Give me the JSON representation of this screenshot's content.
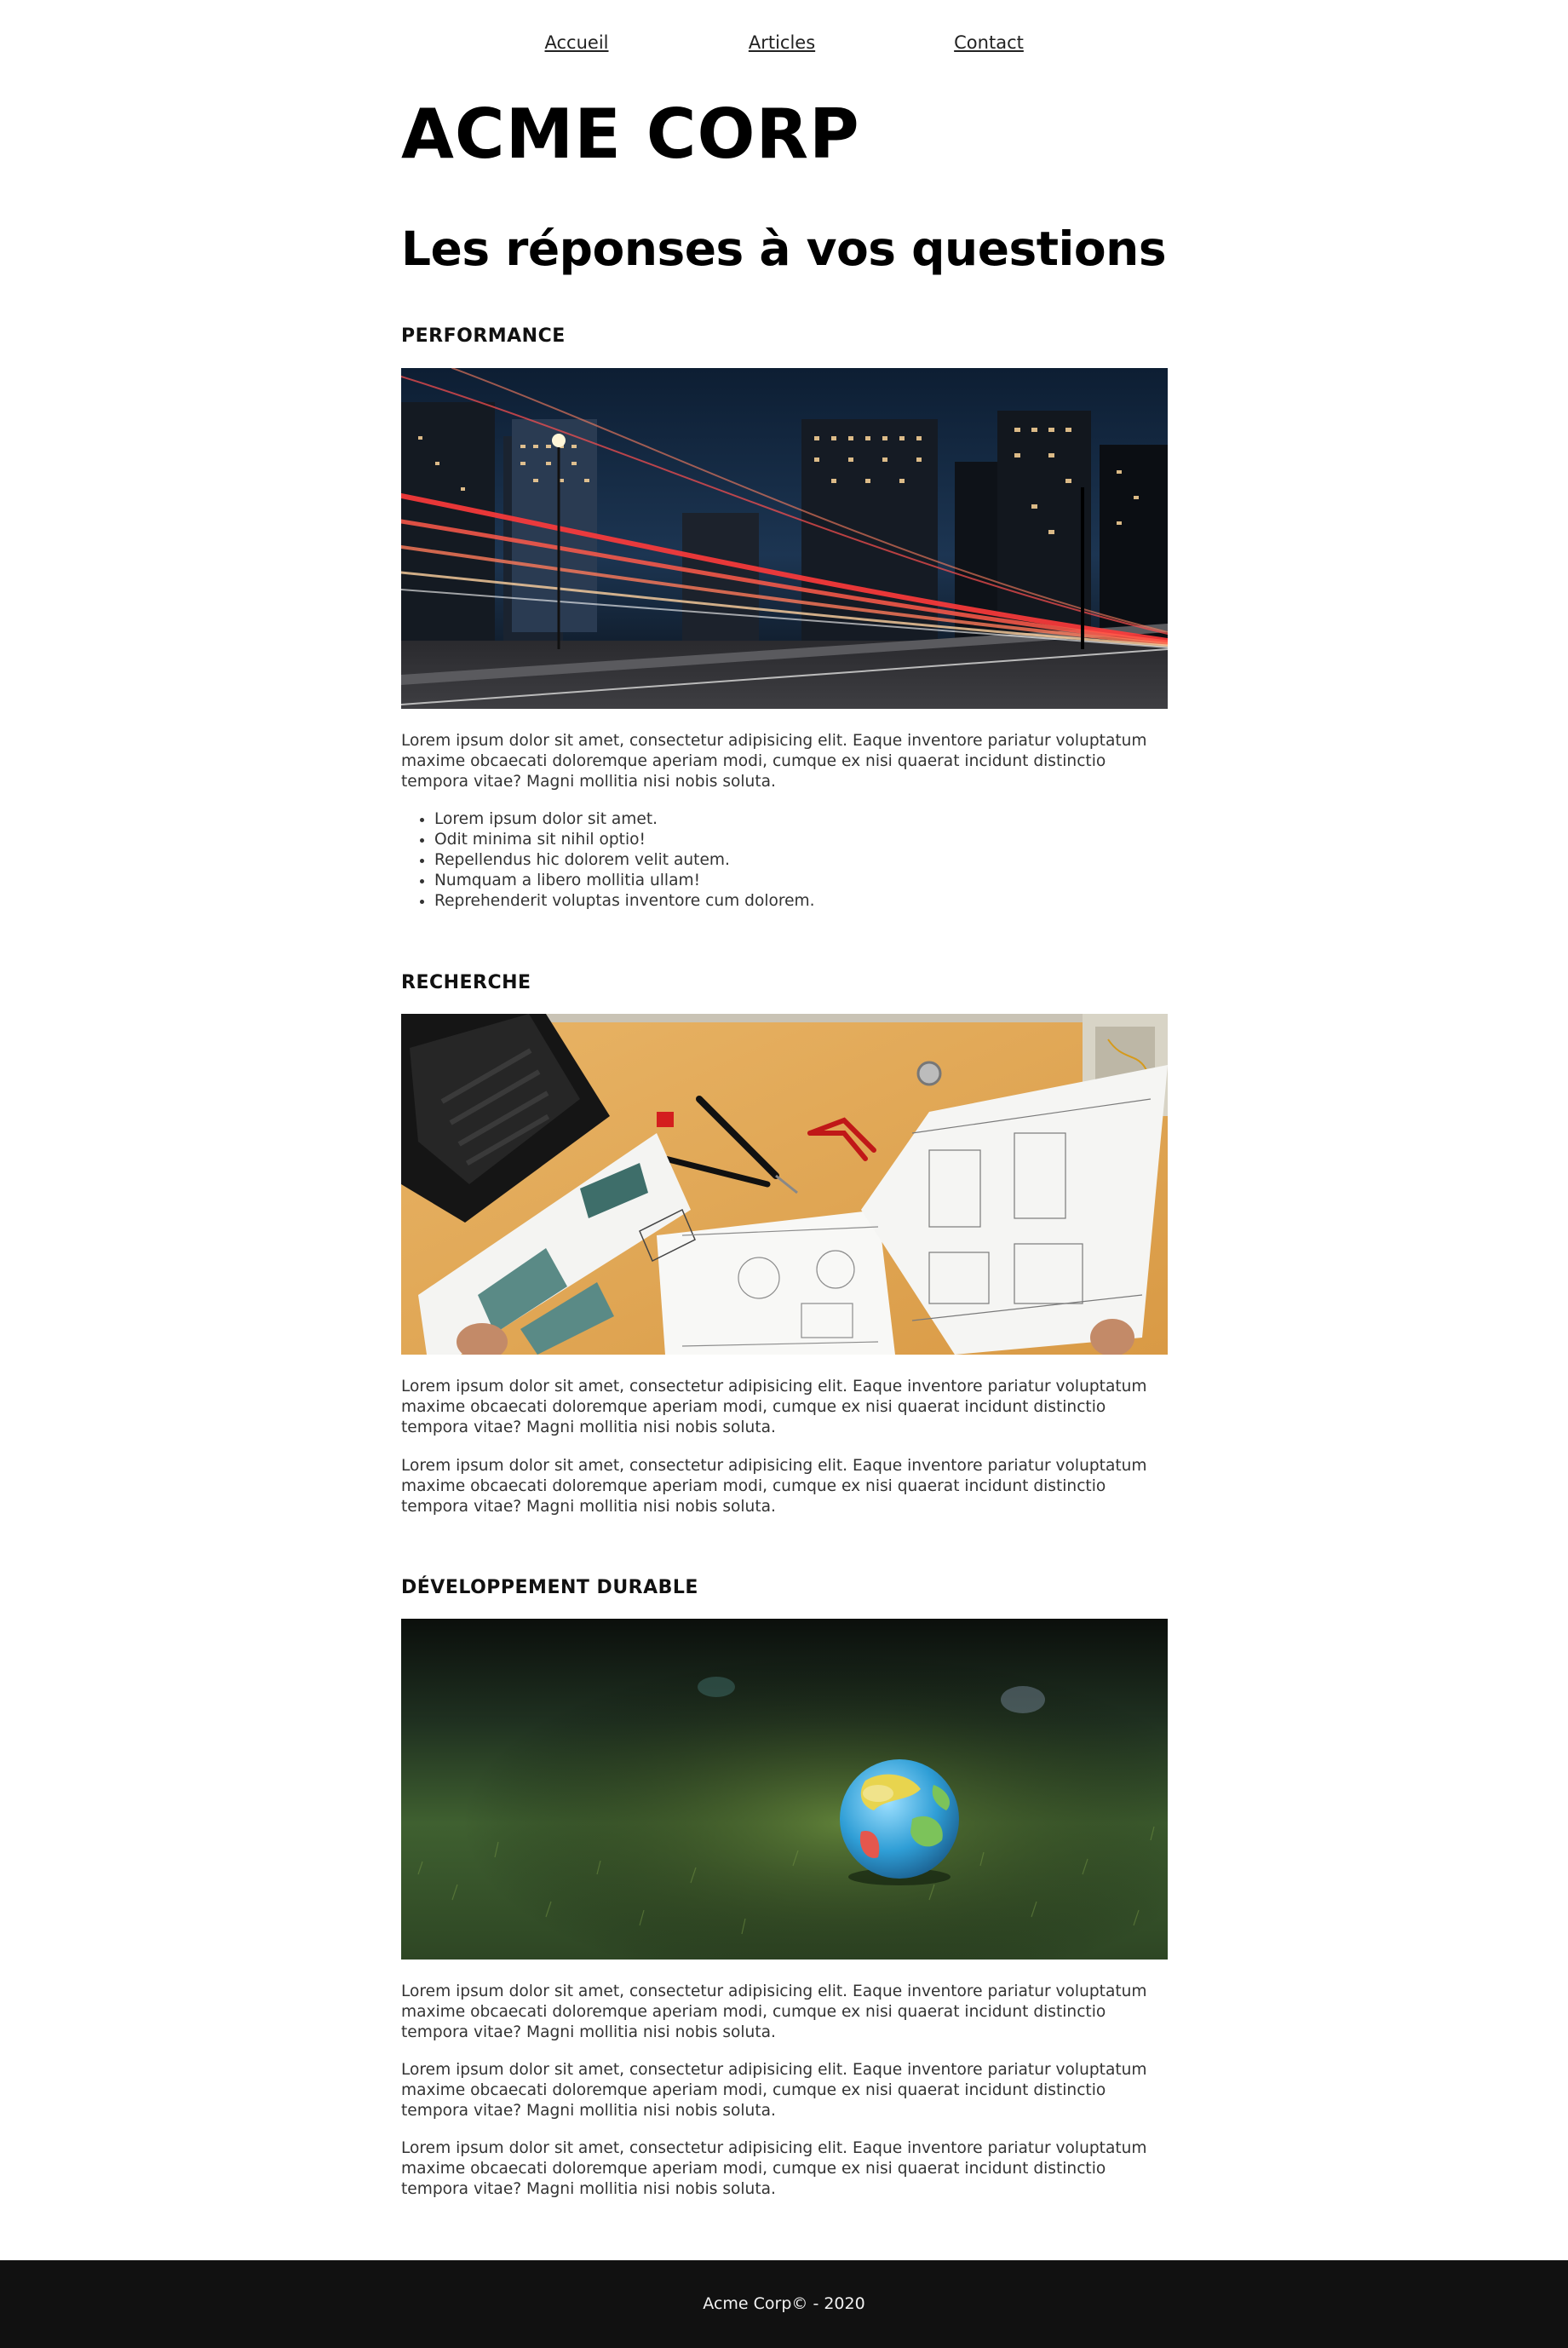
{
  "nav": {
    "items": [
      {
        "label": "Accueil"
      },
      {
        "label": "Articles"
      },
      {
        "label": "Contact"
      }
    ]
  },
  "brand": "ACME CORP",
  "page_title": "Les réponses à vos questions",
  "sections": [
    {
      "title": "PERFORMANCE",
      "image_subject": "city-night-light-trails",
      "paragraphs": [
        "Lorem ipsum dolor sit amet, consectetur adipisicing elit. Eaque inventore pariatur voluptatum maxime obcaecati doloremque aperiam modi, cumque ex nisi quaerat incidunt distinctio tempora vitae? Magni mollitia nisi nobis soluta."
      ],
      "bullets": [
        "Lorem ipsum dolor sit amet.",
        "Odit minima sit nihil optio!",
        "Repellendus hic dolorem velit autem.",
        "Numquam a libero mollitia ullam!",
        "Reprehenderit voluptas inventore cum dolorem."
      ]
    },
    {
      "title": "RECHERCHE",
      "image_subject": "blueprints-on-desk",
      "paragraphs": [
        "Lorem ipsum dolor sit amet, consectetur adipisicing elit. Eaque inventore pariatur voluptatum maxime obcaecati doloremque aperiam modi, cumque ex nisi quaerat incidunt distinctio tempora vitae? Magni mollitia nisi nobis soluta.",
        "Lorem ipsum dolor sit amet, consectetur adipisicing elit. Eaque inventore pariatur voluptatum maxime obcaecati doloremque aperiam modi, cumque ex nisi quaerat incidunt distinctio tempora vitae? Magni mollitia nisi nobis soluta."
      ]
    },
    {
      "title": "DÉVELOPPEMENT DURABLE",
      "image_subject": "globe-on-grass",
      "paragraphs": [
        "Lorem ipsum dolor sit amet, consectetur adipisicing elit. Eaque inventore pariatur voluptatum maxime obcaecati doloremque aperiam modi, cumque ex nisi quaerat incidunt distinctio tempora vitae? Magni mollitia nisi nobis soluta.",
        "Lorem ipsum dolor sit amet, consectetur adipisicing elit. Eaque inventore pariatur voluptatum maxime obcaecati doloremque aperiam modi, cumque ex nisi quaerat incidunt distinctio tempora vitae? Magni mollitia nisi nobis soluta.",
        "Lorem ipsum dolor sit amet, consectetur adipisicing elit. Eaque inventore pariatur voluptatum maxime obcaecati doloremque aperiam modi, cumque ex nisi quaerat incidunt distinctio tempora vitae? Magni mollitia nisi nobis soluta."
      ]
    }
  ],
  "footer": {
    "text": "Acme Corp© - 2020"
  },
  "colors": {
    "footer_background": "#111111",
    "footer_text": "#f2f2f2",
    "body_text": "#333333"
  }
}
